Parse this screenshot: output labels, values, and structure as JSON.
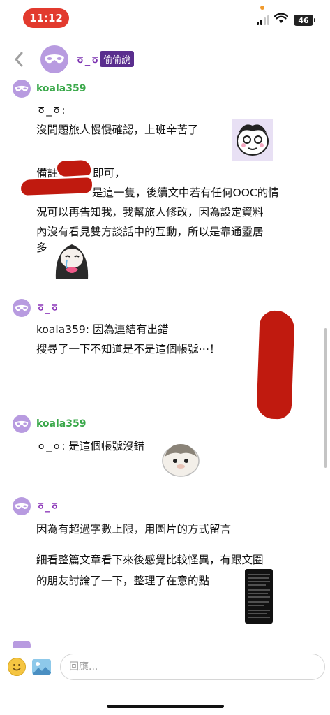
{
  "status_bar": {
    "time": "11:12",
    "battery": "46"
  },
  "header": {
    "name": "ㆆ_ㆆ",
    "badge": "偷偷說"
  },
  "messages": [
    {
      "user": "koala359",
      "lines": [
        "ㆆ_ㆆ:",
        "沒問題旅人慢慢確認，上班辛苦了",
        "",
        "備註",
        "即可，",
        "是這一隻，後續文中若有任何OOC的情",
        "況可以再告知我，我幫旅人修改，因為設定資料",
        "內沒有看見雙方談話中的互動，所以是靠通靈居",
        "多"
      ]
    },
    {
      "user": "ㆆ_ㆆ",
      "lines": [
        "koala359: 因為連結有出錯",
        "搜尋了一下不知道是不是這個帳號⋯！"
      ]
    },
    {
      "user": "koala359",
      "lines": [
        "ㆆ_ㆆ: 是這個帳號沒錯"
      ]
    },
    {
      "user": "ㆆ_ㆆ",
      "lines": [
        "因為有超過字數上限，用圖片的方式留言",
        "細看整篇文章看下來後感覺比較怪異，有跟文圈",
        "的朋友討論了一下，整理了在意的點"
      ]
    }
  ],
  "composer": {
    "placeholder": "回應..."
  }
}
